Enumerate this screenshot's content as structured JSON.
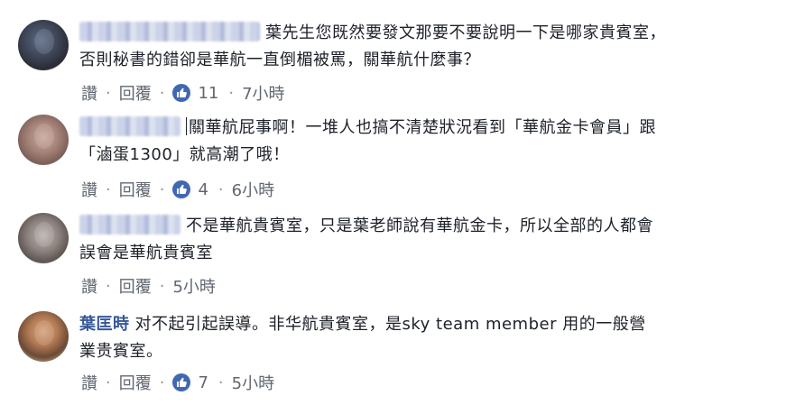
{
  "comments": [
    {
      "name": "",
      "text_line1": "葉先生您既然要發文那要不要說明一下是哪家貴賓室，",
      "text_line2": "否則秘書的錯卻是華航一直倒楣被罵，關華航什麼事？",
      "like_label": "讚",
      "reply_label": "回覆",
      "likes": "11",
      "time": "7小時"
    },
    {
      "name": "",
      "text_line1": "關華航屁事啊！一堆人也搞不清楚狀況看到「華航金卡會員」跟",
      "text_line2": "「滷蛋1300」就高潮了哦！",
      "like_label": "讚",
      "reply_label": "回覆",
      "likes": "4",
      "time": "6小時"
    },
    {
      "name": "",
      "text_line1": "不是華航貴賓室，只是葉老師說有華航金卡，所以全部的人都會",
      "text_line2": "誤會是華航貴賓室",
      "like_label": "讚",
      "reply_label": "回覆",
      "likes": "",
      "time": "5小時"
    },
    {
      "name": "葉匡時",
      "text_line1": "对不起引起誤導。非华航貴賓室，是sky team member 用的一般營",
      "text_line2": "業贵賓室。",
      "like_label": "讚",
      "reply_label": "回覆",
      "likes": "7",
      "time": "5小時"
    }
  ],
  "separator": "·",
  "colors": {
    "name_link": "#365899",
    "meta_text": "#606770",
    "like_blue": "#4267b2"
  },
  "icons": {
    "like": "thumbs-up-icon"
  }
}
